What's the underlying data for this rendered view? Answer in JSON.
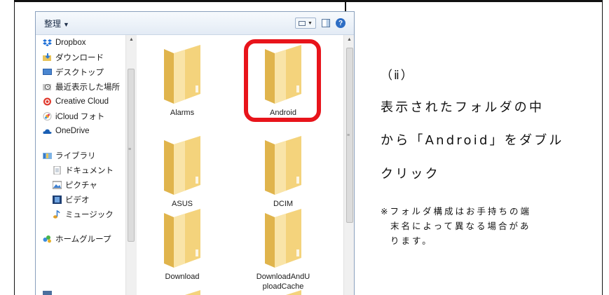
{
  "explorer": {
    "toolbar": {
      "organize_label": "整理",
      "help_glyph": "?"
    },
    "nav_items": [
      {
        "label": "Dropbox",
        "icon": "dropbox-icon"
      },
      {
        "label": "ダウンロード",
        "icon": "download-folder-icon"
      },
      {
        "label": "デスクトップ",
        "icon": "desktop-icon"
      },
      {
        "label": "最近表示した場所",
        "icon": "recent-places-icon"
      },
      {
        "label": "Creative Cloud",
        "icon": "creative-cloud-icon"
      },
      {
        "label": "iCloud フォト",
        "icon": "icloud-photos-icon"
      },
      {
        "label": "OneDrive",
        "icon": "onedrive-icon"
      },
      {
        "label": "ライブラリ",
        "icon": "libraries-icon"
      },
      {
        "label": "ドキュメント",
        "icon": "documents-icon"
      },
      {
        "label": "ピクチャ",
        "icon": "pictures-icon"
      },
      {
        "label": "ビデオ",
        "icon": "videos-icon"
      },
      {
        "label": "ミュージック",
        "icon": "music-icon"
      },
      {
        "label": "ホームグループ",
        "icon": "homegroup-icon"
      }
    ],
    "files": [
      {
        "label": "Alarms"
      },
      {
        "label": "Android",
        "highlighted": true
      },
      {
        "label": "ASUS"
      },
      {
        "label": "DCIM"
      },
      {
        "label": "Download"
      },
      {
        "label": "DownloadAndUploadCache",
        "label_lines": [
          "DownloadAndU",
          "ploadCache"
        ]
      }
    ],
    "highlight_color": "#e8141b"
  },
  "instructions": {
    "step": "（ⅱ）",
    "lines": [
      "表示されたフォルダの中",
      "から「Android」をダブル",
      "クリック"
    ],
    "note_lines": [
      "※フォルダ構成はお手持ちの端",
      "末名によって異なる場合があ",
      "ります。"
    ]
  }
}
